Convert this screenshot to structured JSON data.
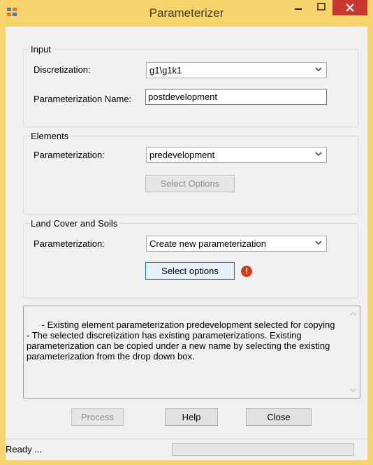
{
  "window": {
    "title": "Parameterizer"
  },
  "input_group": {
    "legend": "Input",
    "discretization_label": "Discretization:",
    "discretization_value": "g1\\g1k1",
    "param_name_label": "Parameterization Name:",
    "param_name_value": "postdevelopment"
  },
  "elements_group": {
    "legend": "Elements",
    "param_label": "Parameterization:",
    "param_value": "predevelopment",
    "select_options_label": "Select Options"
  },
  "landcover_group": {
    "legend": "Land Cover and Soils",
    "param_label": "Parameterization:",
    "param_value": "Create new parameterization",
    "select_options_label": "Select options",
    "warning_glyph": "!"
  },
  "log": {
    "text": "- Existing element parameterization predevelopment selected for copying\n- The selected discretization has existing parameterizations. Existing parameterization can be copied under a new name by selecting the existing parameterization from the drop down box."
  },
  "buttons": {
    "process": "Process",
    "help": "Help",
    "close": "Close"
  },
  "status": {
    "text": "Ready ..."
  },
  "colors": {
    "titlebar": "#f7d36c",
    "close_button": "#c7372f",
    "warning": "#d63a17",
    "focus_border": "#0078d7"
  }
}
